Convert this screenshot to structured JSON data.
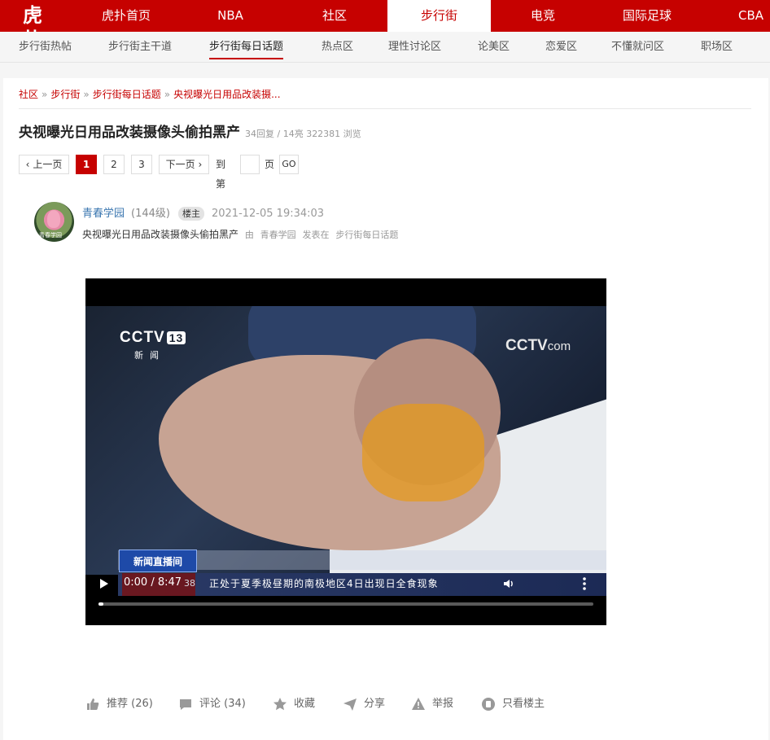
{
  "topnav": {
    "logo": "虎扑",
    "items": [
      {
        "label": "虎扑首页"
      },
      {
        "label": "NBA"
      },
      {
        "label": "社区"
      },
      {
        "label": "步行街"
      },
      {
        "label": "电竞"
      },
      {
        "label": "国际足球"
      },
      {
        "label": "CBA"
      }
    ],
    "active_index": 3
  },
  "subnav": {
    "items": [
      {
        "label": "步行街热帖"
      },
      {
        "label": "步行街主干道"
      },
      {
        "label": "步行街每日话题"
      },
      {
        "label": "热点区"
      },
      {
        "label": "理性讨论区"
      },
      {
        "label": "论美区"
      },
      {
        "label": "恋爱区"
      },
      {
        "label": "不懂就问区"
      },
      {
        "label": "职场区"
      }
    ],
    "active_index": 2
  },
  "breadcrumb": {
    "items": [
      "社区",
      "步行街",
      "步行街每日话题",
      "央视曝光日用品改装摄..."
    ],
    "separator": "»"
  },
  "post": {
    "title": "央视曝光日用品改装摄像头偷拍黑产",
    "meta": "34回复 / 14亮 322381 浏览"
  },
  "pager": {
    "prev": "上一页",
    "pages": [
      "1",
      "2",
      "3"
    ],
    "current": "1",
    "next": "下一页",
    "goto_prefix": "到第",
    "goto_suffix": "页",
    "go": "GO"
  },
  "author": {
    "name": "青春学园",
    "level": "(144级)",
    "badge": "楼主",
    "time": "2021-12-05 19:34:03",
    "avatar_caption": "青春学园",
    "summary_title": "央视曝光日用品改装摄像头偷拍黑产",
    "summary_by": "由",
    "summary_author": "青春学园",
    "summary_posted_in": "发表在",
    "summary_board": "步行街每日话题"
  },
  "video": {
    "channel_logo": "CCTV",
    "channel_number": "13",
    "channel_name": "新闻",
    "watermark": "CCTV",
    "watermark_suffix": "com",
    "live_tag": "新闻直播间",
    "ticker_time": "38",
    "ticker_text": "正处于夏季极昼期的南极地区4日出现日全食现象",
    "current_time": "0:00",
    "duration": "8:47",
    "progress": 0.01
  },
  "actions": [
    {
      "icon": "thumbs-up-icon",
      "label": "推荐 (26)"
    },
    {
      "icon": "comment-icon",
      "label": "评论 (34)"
    },
    {
      "icon": "star-icon",
      "label": "收藏"
    },
    {
      "icon": "share-icon",
      "label": "分享"
    },
    {
      "icon": "warning-icon",
      "label": "举报"
    },
    {
      "icon": "host-only-icon",
      "label": "只看楼主"
    }
  ],
  "colors": {
    "brand": "#c60100",
    "link": "#3b77b0"
  }
}
